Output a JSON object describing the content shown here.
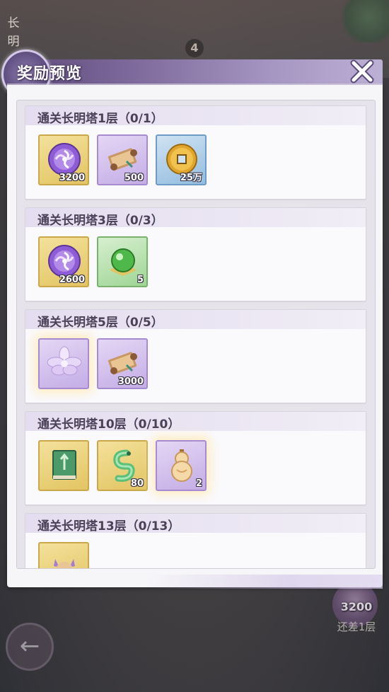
{
  "background": {
    "side_text": [
      "长",
      "明"
    ],
    "floor_badge": "4",
    "coin_amount": "3200",
    "coin_label": "还差1层"
  },
  "modal": {
    "title": "奖励预览"
  },
  "reward_groups": [
    {
      "title": "通关长明塔1层（0/1）",
      "items": [
        {
          "icon": "purple-swirl-orb-icon",
          "rarity": "gold",
          "count": "3200",
          "glow": false
        },
        {
          "icon": "scroll-icon",
          "rarity": "purple",
          "count": "500",
          "glow": false
        },
        {
          "icon": "copper-coin-icon",
          "rarity": "blue",
          "count": "25万",
          "glow": false
        }
      ]
    },
    {
      "title": "通关长明塔3层（0/3）",
      "items": [
        {
          "icon": "purple-swirl-orb-icon",
          "rarity": "gold",
          "count": "2600",
          "glow": false
        },
        {
          "icon": "green-orb-icon",
          "rarity": "green",
          "count": "5",
          "glow": false
        }
      ]
    },
    {
      "title": "通关长明塔5层（0/5）",
      "items": [
        {
          "icon": "lotus-flower-icon",
          "rarity": "purple",
          "count": "",
          "glow": true
        },
        {
          "icon": "scroll-icon",
          "rarity": "purple",
          "count": "3000",
          "glow": false
        }
      ]
    },
    {
      "title": "通关长明塔10层（0/10）",
      "items": [
        {
          "icon": "green-book-icon",
          "rarity": "gold",
          "count": "",
          "glow": false
        },
        {
          "icon": "jade-dragon-icon",
          "rarity": "gold",
          "count": "80",
          "glow": false
        },
        {
          "icon": "gourd-icon",
          "rarity": "purple",
          "count": "2",
          "glow": true
        }
      ]
    },
    {
      "title": "通关长明塔13层（0/13）",
      "items": [
        {
          "icon": "fox-charm-icon",
          "rarity": "gold",
          "count": "",
          "glow": false
        }
      ]
    }
  ]
}
